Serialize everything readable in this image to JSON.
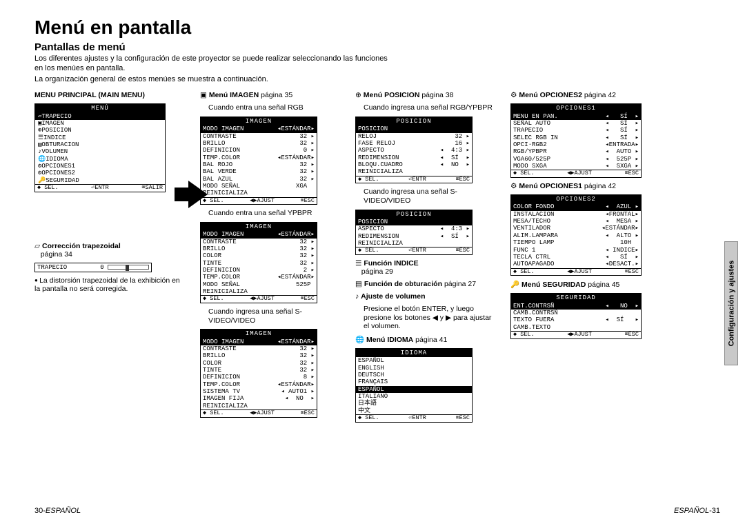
{
  "title": "Menú en pantalla",
  "subtitle": "Pantallas de menú",
  "intro1": "Los diferentes ajustes y la configuración de este proyector se puede realizar seleccionando las funciones en los menúes en pantalla.",
  "intro2": "La organización general de estos menúes se muestra a continuación.",
  "sideTab": "Configuración y ajustes",
  "footerLeft": {
    "num": "30-",
    "word": "ESPAÑOL"
  },
  "footerRight": {
    "word": "ESPAÑOL",
    "num": "-31"
  },
  "mainMenu": {
    "caption": "MENU PRINCIPAL (MAIN MENU)",
    "title": "MENÚ",
    "items": [
      {
        "icon": "▱",
        "label": "TRAPECIO",
        "sel": true
      },
      {
        "icon": "▣",
        "label": "IMAGEN"
      },
      {
        "icon": "⊕",
        "label": "POSICION"
      },
      {
        "icon": "☰",
        "label": "INDICE"
      },
      {
        "icon": "▤",
        "label": "OBTURACION"
      },
      {
        "icon": "♪",
        "label": "VOLUMEN"
      },
      {
        "icon": "🌐",
        "label": "IDIOMA"
      },
      {
        "icon": "⚙",
        "label": "OPCIONES1"
      },
      {
        "icon": "⚙",
        "label": "OPCIONES2"
      },
      {
        "icon": "🔑",
        "label": "SEGURIDAD"
      }
    ],
    "footer": {
      "a": "◆ SEL.",
      "b": "⏎ENTR",
      "c": "⌧SALIR"
    }
  },
  "trapezoid": {
    "captionIcon": "▱",
    "captionBold": "Corrección trapezoidal",
    "captionRest": "página 34",
    "boxLabel": "TRAPECIO",
    "boxValue": "0",
    "note": "La distorsión trapezoidal de la exhibición en la pantalla no será corregida."
  },
  "imagen": {
    "caption": "Menú IMAGEN",
    "captionRest": "página 35",
    "sub_rgb": "Cuando entra una señal RGB",
    "sub_ypbpr": "Cuando entra una señal YPBPR",
    "sub_svideo": "Cuando ingresa una señal S-VIDEO/VIDEO",
    "title": "IMAGEN",
    "modeRow": {
      "l": "MODO IMAGEN",
      "r": "◂ESTÁNDAR▸"
    },
    "rgbRows": [
      {
        "l": "CONTRASTE",
        "r": "32 ▸"
      },
      {
        "l": "BRILLO",
        "r": "32 ▸"
      },
      {
        "l": "DEFINICION",
        "r": " 0 ▸"
      },
      {
        "l": "TEMP.COLOR",
        "r": "◂ESTÁNDAR▸"
      },
      {
        "l": "BAL ROJO",
        "r": "32 ▸"
      },
      {
        "l": "BAL VERDE",
        "r": "32 ▸"
      },
      {
        "l": "BAL AZUL",
        "r": "32 ▸"
      },
      {
        "l": "MODO SEÑAL",
        "r": "XGA  "
      },
      {
        "l": "REINICIALIZA",
        "r": ""
      }
    ],
    "ypbprRows": [
      {
        "l": "CONTRASTE",
        "r": "32 ▸"
      },
      {
        "l": "BRILLO",
        "r": "32 ▸"
      },
      {
        "l": "COLOR",
        "r": "32 ▸"
      },
      {
        "l": "TINTE",
        "r": "32 ▸"
      },
      {
        "l": "DEFINICION",
        "r": " 2 ▸"
      },
      {
        "l": "TEMP.COLOR",
        "r": "◂ESTÁNDAR▸"
      },
      {
        "l": "MODO SEÑAL",
        "r": "525P "
      },
      {
        "l": "REINICIALIZA",
        "r": ""
      }
    ],
    "svideoRows": [
      {
        "l": "CONTRASTE",
        "r": "32 ▸"
      },
      {
        "l": "BRILLO",
        "r": "32 ▸"
      },
      {
        "l": "COLOR",
        "r": "32 ▸"
      },
      {
        "l": "TINTE",
        "r": "32 ▸"
      },
      {
        "l": "DEFINICION",
        "r": " 8 ▸"
      },
      {
        "l": "TEMP.COLOR",
        "r": "◂ESTÁNDAR▸"
      },
      {
        "l": "SISTEMA TV",
        "r": "◂ AUTO1 ▸"
      },
      {
        "l": "IMAGEN FIJA",
        "r": "◂  NO  ▸"
      },
      {
        "l": "REINICIALIZA",
        "r": ""
      }
    ],
    "footer": {
      "a": "◆ SEL.",
      "b": "◀▶AJUST",
      "c": "⌧ESC"
    }
  },
  "posicion": {
    "caption": "Menú POSICION",
    "captionRest": "página 38",
    "sub_rgb": "Cuando ingresa una señal RGB/YPBPR",
    "sub_svideo": "Cuando ingresa una señal S-VIDEO/VIDEO",
    "title": "POSICION",
    "rgbRows": [
      {
        "l": "POSICION",
        "r": "",
        "sel": true
      },
      {
        "l": "RELOJ",
        "r": "32 ▸"
      },
      {
        "l": "FASE RELOJ",
        "r": "16 ▸"
      },
      {
        "l": "ASPECTO",
        "r": "◂  4:3 ▸"
      },
      {
        "l": "REDIMENSION",
        "r": "◂  SÍ  ▸"
      },
      {
        "l": "BLOQU.CUADRO",
        "r": "◂  NO  ▸"
      },
      {
        "l": "REINICIALIZA",
        "r": ""
      }
    ],
    "svideoRows": [
      {
        "l": "POSICION",
        "r": "",
        "sel": true
      },
      {
        "l": "ASPECTO",
        "r": "◂  4:3 ▸"
      },
      {
        "l": "REDIMENSION",
        "r": "◂  SÍ  ▸"
      },
      {
        "l": "REINICIALIZA",
        "r": ""
      }
    ],
    "footerEntr": {
      "a": "◆ SEL.",
      "b": "⏎ENTR",
      "c": "⌧ESC"
    }
  },
  "indice": {
    "captionBold": "Función INDICE",
    "captionRest": "página 29"
  },
  "obturacion": {
    "captionBold": "Función de obturación",
    "captionRest": "página 27"
  },
  "volumen": {
    "captionBold": "Ajuste de volumen",
    "line1": "Presione el botón ENTER, y luego presione los botones ◀ y ▶ para ajustar el volumen."
  },
  "idioma": {
    "caption": "Menú IDIOMA",
    "captionRest": "página 41",
    "title": "IDIOMA",
    "items": [
      "ESPAÑOL",
      "ENGLISH",
      "DEUTSCH",
      "FRANÇAIS",
      "ESPAÑOL",
      "ITALIANO",
      "日本語",
      "中文"
    ],
    "selIndex": 4,
    "footer": {
      "a": "◆ SEL.",
      "b": "⏎ENTR",
      "c": "⌧ESC"
    }
  },
  "opciones2cap": {
    "caption": "Menú OPCIONES2",
    "captionRest": "página 42"
  },
  "opciones1box": {
    "title": "OPCIONES1",
    "rows": [
      {
        "l": "MENU EN PAN.",
        "r": "◂   SÍ  ▸",
        "sel": true
      },
      {
        "l": "SEÑAL AUTO",
        "r": "◂   SÍ  ▸"
      },
      {
        "l": "TRAPECIO",
        "r": "◂   SÍ  ▸"
      },
      {
        "l": "SELEC RGB IN",
        "r": "◂   SÍ  ▸"
      },
      {
        "l": "OPCI·RGB2",
        "r": "◂ENTRADA▸"
      },
      {
        "l": "RGB/YPBPR",
        "r": "◂  AUTO ▸"
      },
      {
        "l": "VGA60/525P",
        "r": "◂  525P ▸"
      },
      {
        "l": "MODO SXGA",
        "r": "◂  SXGA ▸"
      }
    ],
    "footer": {
      "a": "◆ SEL.",
      "b": "◀▶AJUST",
      "c": "⌧ESC"
    }
  },
  "opciones1cap": {
    "caption": "Menú OPCIONES1",
    "captionRest": "página 42"
  },
  "opciones2box": {
    "title": "OPCIONES2",
    "rows": [
      {
        "l": "COLOR FONDO",
        "r": "◂  AZUL ▸",
        "sel": true
      },
      {
        "l": "INSTALACION",
        "r": "◂FRONTAL▸"
      },
      {
        "l": "MESA/TECHO",
        "r": "◂  MESA ▸"
      },
      {
        "l": "VENTILADOR",
        "r": "◂ESTÁNDAR▸"
      },
      {
        "l": "ALIM.LAMPARA",
        "r": "◂  ALTO ▸"
      },
      {
        "l": "TIEMPO LAMP",
        "r": "   10H  "
      },
      {
        "l": "FUNC 1",
        "r": "◂ INDICE▸"
      },
      {
        "l": "TECLA CTRL",
        "r": "◂   SÍ  ▸"
      },
      {
        "l": "AUTOAPAGADO",
        "r": "◂DESACT.▸"
      }
    ],
    "footer": {
      "a": "◆ SEL.",
      "b": "◀▶AJUST",
      "c": "⌧ESC"
    }
  },
  "seguridad": {
    "caption": "Menú SEGURIDAD",
    "captionRest": "página 45",
    "title": "SEGURIDAD",
    "rows": [
      {
        "l": "ENT.CONTRSÑ",
        "r": "◂   NO  ▸",
        "sel": true
      },
      {
        "l": "CAMB.CONTRSÑ",
        "r": ""
      },
      {
        "l": "TEXTO FUERA",
        "r": "◂  SÍ   ▸"
      },
      {
        "l": "CAMB.TEXTO",
        "r": ""
      }
    ],
    "footer": {
      "a": "◆ SEL.",
      "b": "◀▶AJUST",
      "c": "⌧ESC"
    }
  }
}
